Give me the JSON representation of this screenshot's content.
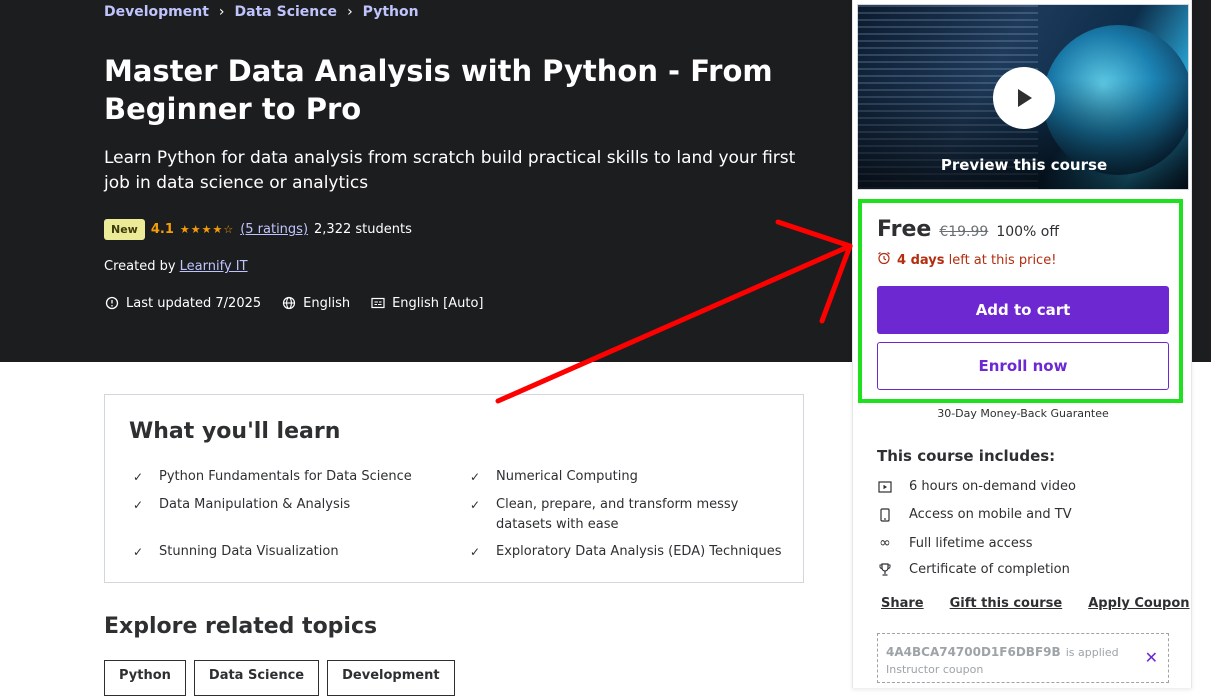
{
  "breadcrumb": [
    "Development",
    "Data Science",
    "Python"
  ],
  "course": {
    "title": "Master Data Analysis with Python - From Beginner to Pro",
    "subtitle": "Learn Python for data analysis from scratch build practical skills to land your first job in data science or analytics",
    "badge": "New",
    "rating": "4.1",
    "rating_stars": 4.1,
    "ratings_link": "(5 ratings)",
    "students": "2,322 students",
    "created_by_label": "Created by",
    "instructor": "Learnify IT",
    "last_updated": "Last updated 7/2025",
    "language": "English",
    "captions": "English [Auto]"
  },
  "learn": {
    "title": "What you'll learn",
    "items": [
      "Python Fundamentals for Data Science",
      "Numerical Computing",
      "Data Manipulation & Analysis",
      "Clean, prepare, and transform messy datasets with ease",
      "Stunning Data Visualization",
      "Exploratory Data Analysis (EDA) Techniques"
    ]
  },
  "related": {
    "title": "Explore related topics",
    "topics": [
      "Python",
      "Data Science",
      "Development"
    ]
  },
  "sidebar": {
    "preview_label": "Preview this course",
    "price": "Free",
    "old_price": "€19.99",
    "discount": "100% off",
    "timer_bold": "4 days",
    "timer_rest": "left at this price!",
    "add_to_cart": "Add to cart",
    "enroll_now": "Enroll now",
    "guarantee": "30-Day Money-Back Guarantee",
    "includes_title": "This course includes:",
    "includes": [
      "6 hours on-demand video",
      "Access on mobile and TV",
      "Full lifetime access",
      "Certificate of completion"
    ],
    "links": [
      "Share",
      "Gift this course",
      "Apply Coupon"
    ],
    "coupon_code": "4A4BCA74700D1F6DBF9B",
    "coupon_applied": "is applied",
    "coupon_type": "Instructor coupon"
  },
  "colors": {
    "hero_bg": "#1c1d1f",
    "accent_purple": "#6d28d2",
    "link_lavender": "#c0c4fc",
    "star_orange": "#f69c08",
    "annotation_red": "#ff0000",
    "annotation_green": "#1fe01f"
  }
}
